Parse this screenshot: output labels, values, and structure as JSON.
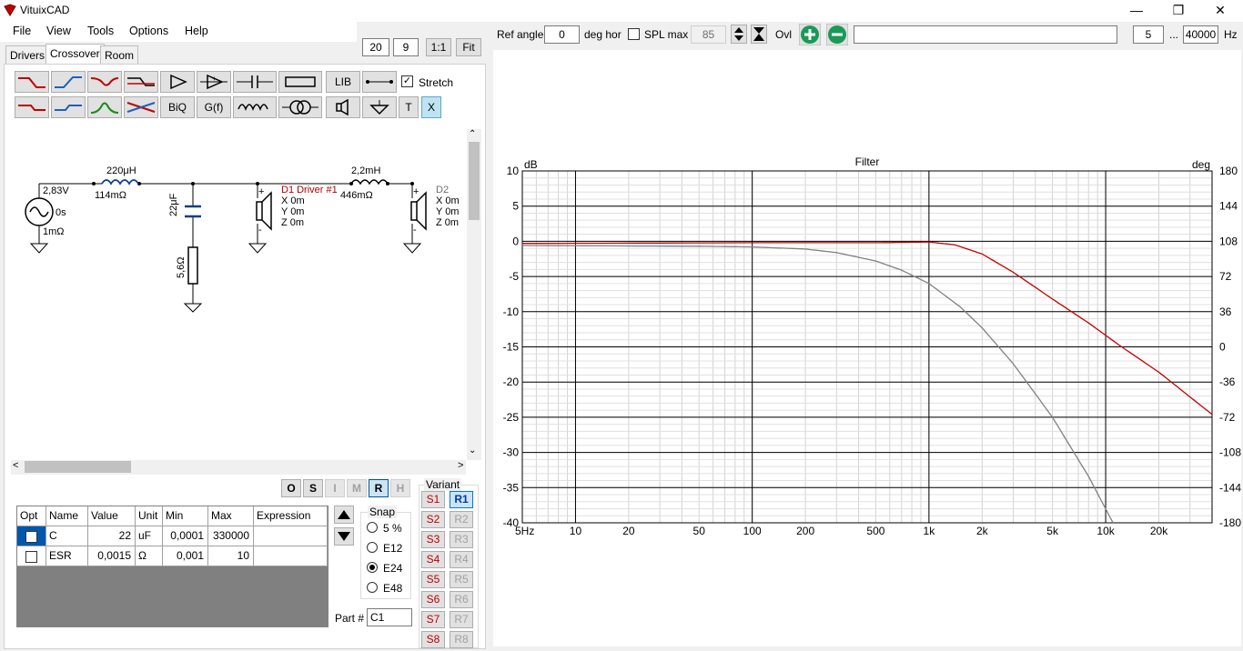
{
  "app": {
    "title": "VituixCAD"
  },
  "menu": [
    "File",
    "View",
    "Tools",
    "Options",
    "Help"
  ],
  "view_buttons": {
    "w": "20",
    "h": "9",
    "one_to_one": "1:1",
    "fit": "Fit"
  },
  "tabs": [
    "Drivers",
    "Crossover",
    "Room"
  ],
  "toolbar": {
    "lib": "LIB",
    "stretch": "Stretch",
    "biq": "BiQ",
    "gf": "G(f)",
    "t": "T",
    "x": "X"
  },
  "schematic": {
    "source_voltage": "2,83V",
    "source_delay": "0s",
    "source_resistance": "1mΩ",
    "l1_value": "220μH",
    "l1_resistance": "114mΩ",
    "c1_value": "22μF",
    "r1_value": "5,6Ω",
    "d1_name": "D1 Driver #1",
    "d1_x": "X 0m",
    "d1_y": "Y 0m",
    "d1_z": "Z 0m",
    "l2_value": "2,2mH",
    "l2_resistance": "446mΩ",
    "d2_name": "D2",
    "d2_x": "X 0m",
    "d2_y": "Y 0m",
    "d2_z": "Z 0m"
  },
  "mode_buttons": [
    "O",
    "S",
    "I",
    "M",
    "R",
    "H"
  ],
  "param_table": {
    "headers": [
      "Opt",
      "Name",
      "Value",
      "Unit",
      "Min",
      "Max",
      "Expression"
    ],
    "rows": [
      {
        "name": "C",
        "value": "22",
        "unit": "uF",
        "min": "0,0001",
        "max": "330000",
        "expression": ""
      },
      {
        "name": "ESR",
        "value": "0,0015",
        "unit": "Ω",
        "min": "0,001",
        "max": "10",
        "expression": ""
      }
    ]
  },
  "snap": {
    "title": "Snap",
    "options": [
      "5 %",
      "E12",
      "E24",
      "E48"
    ],
    "selected": "E24"
  },
  "part": {
    "label": "Part #",
    "value": "C1"
  },
  "variant": {
    "title": "Variant",
    "s": [
      "S1",
      "S2",
      "S3",
      "S4",
      "S5",
      "S6",
      "S7",
      "S8"
    ],
    "r": [
      "R1",
      "R2",
      "R3",
      "R4",
      "R5",
      "R6",
      "R7",
      "R8"
    ]
  },
  "top_controls": {
    "ref_angle_label": "Ref angle",
    "ref_angle_value": "0",
    "deg_hor_label": "deg hor",
    "spl_max_label": "SPL max",
    "spl_max_value": "85",
    "ovl_label": "Ovl",
    "freq_min": "5",
    "ellipsis": "...",
    "freq_max": "40000",
    "hz_label": "Hz"
  },
  "colors": {
    "red_trace": "#c00000",
    "gray_trace": "#808080",
    "circuit_blue": "#0b3d91",
    "driver_red": "#b00000"
  },
  "chart_data": {
    "type": "line",
    "title": "Filter",
    "xlabel": "",
    "ylabel_left": "dB",
    "ylabel_right": "deg",
    "x_scale": "log",
    "xlim": [
      5,
      40000
    ],
    "ylim": [
      -40,
      10
    ],
    "ylim_right": [
      -180,
      180
    ],
    "x_ticks": [
      "5Hz",
      "10",
      "20",
      "50",
      "100",
      "200",
      "500",
      "1k",
      "2k",
      "5k",
      "10k",
      "20k"
    ],
    "x_tick_values": [
      5,
      10,
      20,
      50,
      100,
      200,
      500,
      1000,
      2000,
      5000,
      10000,
      20000
    ],
    "y_ticks": [
      10,
      5,
      0,
      -5,
      -10,
      -15,
      -20,
      -25,
      -30,
      -35,
      -40
    ],
    "y_ticks_right": [
      180,
      144,
      108,
      72,
      36,
      0,
      -36,
      -72,
      -108,
      -144,
      -180
    ],
    "grid": true,
    "series": [
      {
        "color": "#c00000",
        "x": [
          5,
          100,
          500,
          1000,
          1400,
          2000,
          3000,
          5000,
          8000,
          12000,
          20000,
          40000
        ],
        "y": [
          -0.3,
          -0.2,
          -0.2,
          -0.1,
          -0.5,
          -1.8,
          -4.4,
          -8.2,
          -11.6,
          -14.8,
          -18.6,
          -24.6
        ]
      },
      {
        "color": "#808080",
        "x": [
          5,
          50,
          100,
          200,
          300,
          500,
          700,
          1000,
          1500,
          2000,
          3000,
          5000,
          8000,
          11000
        ],
        "y": [
          -0.6,
          -0.7,
          -0.8,
          -1.1,
          -1.6,
          -2.8,
          -4.1,
          -6.0,
          -9.3,
          -12.3,
          -17.4,
          -25.0,
          -33.4,
          -40
        ]
      }
    ]
  }
}
